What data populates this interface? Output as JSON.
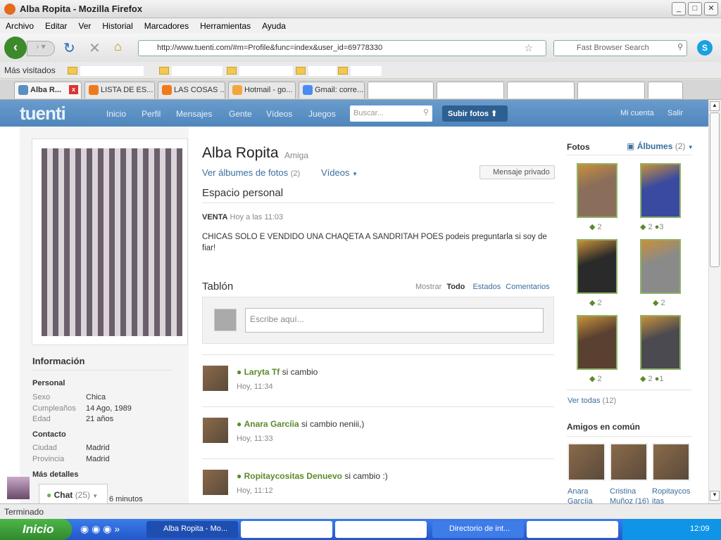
{
  "window": {
    "title": "Alba Ropita - Mozilla Firefox"
  },
  "menu": [
    "Archivo",
    "Editar",
    "Ver",
    "Historial",
    "Marcadores",
    "Herramientas",
    "Ayuda"
  ],
  "toolbar": {
    "url": "http://www.tuenti.com/#m=Profile&func=index&user_id=69778330",
    "search_placeholder": "Fast Browser Search"
  },
  "bookmarks": {
    "most_visited": "Más visitados"
  },
  "tabs": [
    {
      "label": "Alba R...",
      "active": true
    },
    {
      "label": "LISTA DE ES..."
    },
    {
      "label": "LAS COSAS ..."
    },
    {
      "label": "Hotmail - go..."
    },
    {
      "label": "Gmail: corre..."
    }
  ],
  "site": {
    "logo": "tuenti",
    "nav": [
      "Inicio",
      "Perfil",
      "Mensajes",
      "Gente",
      "Vídeos",
      "Juegos"
    ],
    "search_placeholder": "Buscar...",
    "upload": "Subir fotos",
    "account": "Mi cuenta",
    "logout": "Salir",
    "accent": "#5b8ec1"
  },
  "profile": {
    "name": "Alba Ropita",
    "relation": "Amiga",
    "albums_link": "Ver álbumes de fotos",
    "albums_count": "(2)",
    "videos": "Vídeos",
    "private_msg": "Mensaje privado",
    "space_title": "Espacio personal",
    "space_heading": "VENTA",
    "space_time": "Hoy a las 11:03",
    "space_text": "CHICAS SOLO E VENDIDO UNA CHAQETA A SANDRITAH POES podeis preguntarla si soy de fiar!"
  },
  "info": {
    "title": "Información",
    "personal": "Personal",
    "rows1": [
      [
        "Sexo",
        "Chica"
      ],
      [
        "Cumpleaños",
        "14 Ago, 1989"
      ],
      [
        "Edad",
        "21 años"
      ]
    ],
    "contacto": "Contacto",
    "rows2": [
      [
        "Ciudad",
        "Madrid"
      ],
      [
        "Provincia",
        "Madrid"
      ]
    ],
    "more": "Más detalles"
  },
  "wall": {
    "title": "Tablón",
    "show": "Mostrar",
    "filters": [
      "Todo",
      "Estados",
      "Comentarios"
    ],
    "placeholder": "Escribe aquí...",
    "posts": [
      {
        "author": "Laryta Tf",
        "text": "si cambio",
        "time": "Hoy, 11:34"
      },
      {
        "author": "Anara Garcíia",
        "text": "si cambio neniii,)",
        "time": "Hoy, 11:33"
      },
      {
        "author": "Ropitaycositas Denuevo",
        "text": "si cambio :)",
        "time": "Hoy, 11:12"
      }
    ]
  },
  "photos": {
    "title": "Fotos",
    "albums": "Álbumes",
    "albums_count": "(2)",
    "items": [
      {
        "tags": "2",
        "comments": ""
      },
      {
        "tags": "2",
        "comments": "3"
      },
      {
        "tags": "2",
        "comments": ""
      },
      {
        "tags": "2",
        "comments": ""
      },
      {
        "tags": "2",
        "comments": ""
      },
      {
        "tags": "2",
        "comments": "1"
      }
    ],
    "see_all": "Ver todas",
    "see_all_count": "(12)"
  },
  "friends": {
    "title": "Amigos en común",
    "items": [
      {
        "name": "Anara Garcíia"
      },
      {
        "name": "Cristina Muñoz (16)"
      },
      {
        "name": "Ropitaycos itas"
      }
    ]
  },
  "chat": {
    "label": "Chat",
    "count": "(25)",
    "ago": "6 minutos"
  },
  "status": "Terminado",
  "taskbar": {
    "start": "Inicio",
    "tasks": [
      "Alba Ropita - Mo...",
      "Directorio de int..."
    ],
    "clock": "12:09"
  }
}
